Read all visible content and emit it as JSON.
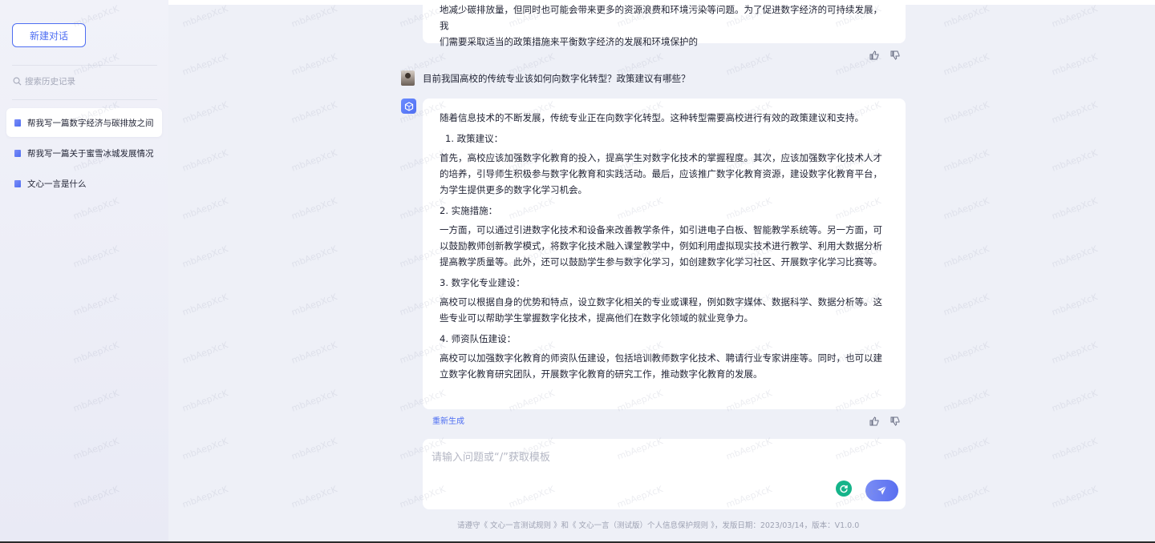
{
  "sidebar": {
    "new_chat_label": "新建对话",
    "search_placeholder": "搜索历史记录",
    "history": [
      "帮我写一篇数字经济与碳排放之间",
      "帮我写一篇关于蜜雪冰城发展情况",
      "文心一言是什么"
    ]
  },
  "conversation": {
    "prev_answer_tail": [
      "地减少碳排放量，但同时也可能会带来更多的资源浪费和环境污染等问题。为了促进数字经济的可持续发展，我",
      "们需要采取适当的政策措施来平衡数字经济的发展和环境保护的"
    ],
    "user_question": "目前我国高校的传统专业该如何向数字化转型？政策建议有哪些？",
    "answer": [
      "随着信息技术的不断发展，传统专业正在向数字化转型。这种转型需要高校进行有效的政策建议和支持。",
      "1. 政策建议：",
      "首先，高校应该加强数字化教育的投入，提高学生对数字化技术的掌握程度。其次，应该加强数字化技术人才的培养，引导师生积极参与数字化教育和实践活动。最后，应该推广数字化教育资源，建设数字化教育平台，为学生提供更多的数字化学习机会。",
      "2. 实施措施：",
      "一方面，可以通过引进数字化技术和设备来改善教学条件，如引进电子白板、智能教学系统等。另一方面，可以鼓励教师创新教学模式，将数字化技术融入课堂教学中，例如利用虚拟现实技术进行教学、利用大数据分析提高教学质量等。此外，还可以鼓励学生参与数字化学习，如创建数字化学习社区、开展数字化学习比赛等。",
      "3. 数字化专业建设：",
      "高校可以根据自身的优势和特点，设立数字化相关的专业或课程，例如数字媒体、数据科学、数据分析等。这些专业可以帮助学生掌握数字化技术，提高他们在数字化领域的就业竞争力。",
      "4. 师资队伍建设：",
      "高校可以加强数字化教育的师资队伍建设，包括培训教师数字化技术、聘请行业专家讲座等。同时，也可以建立数字化教育研究团队，开展数字化教育的研究工作，推动数字化教育的发展。"
    ],
    "regenerate_label": "重新生成"
  },
  "input": {
    "placeholder": "请输入问题或“/”获取模板"
  },
  "footer": {
    "note": "请遵守《 文心一言测试规则 》和《 文心一言（测试版）个人信息保护规则 》，发版日期：2023/03/14，版本：V1.0.0"
  },
  "watermark_text": "mbAepXcK",
  "icons": [
    "search-icon",
    "chat-icon",
    "thumb-up-icon",
    "thumb-down-icon",
    "bot-logo-icon",
    "grammar-icon",
    "send-icon"
  ],
  "colors": {
    "accent": "#4e6ef2",
    "sidebar_bg": "#eef0f7",
    "grammar_green": "#15b48a"
  }
}
